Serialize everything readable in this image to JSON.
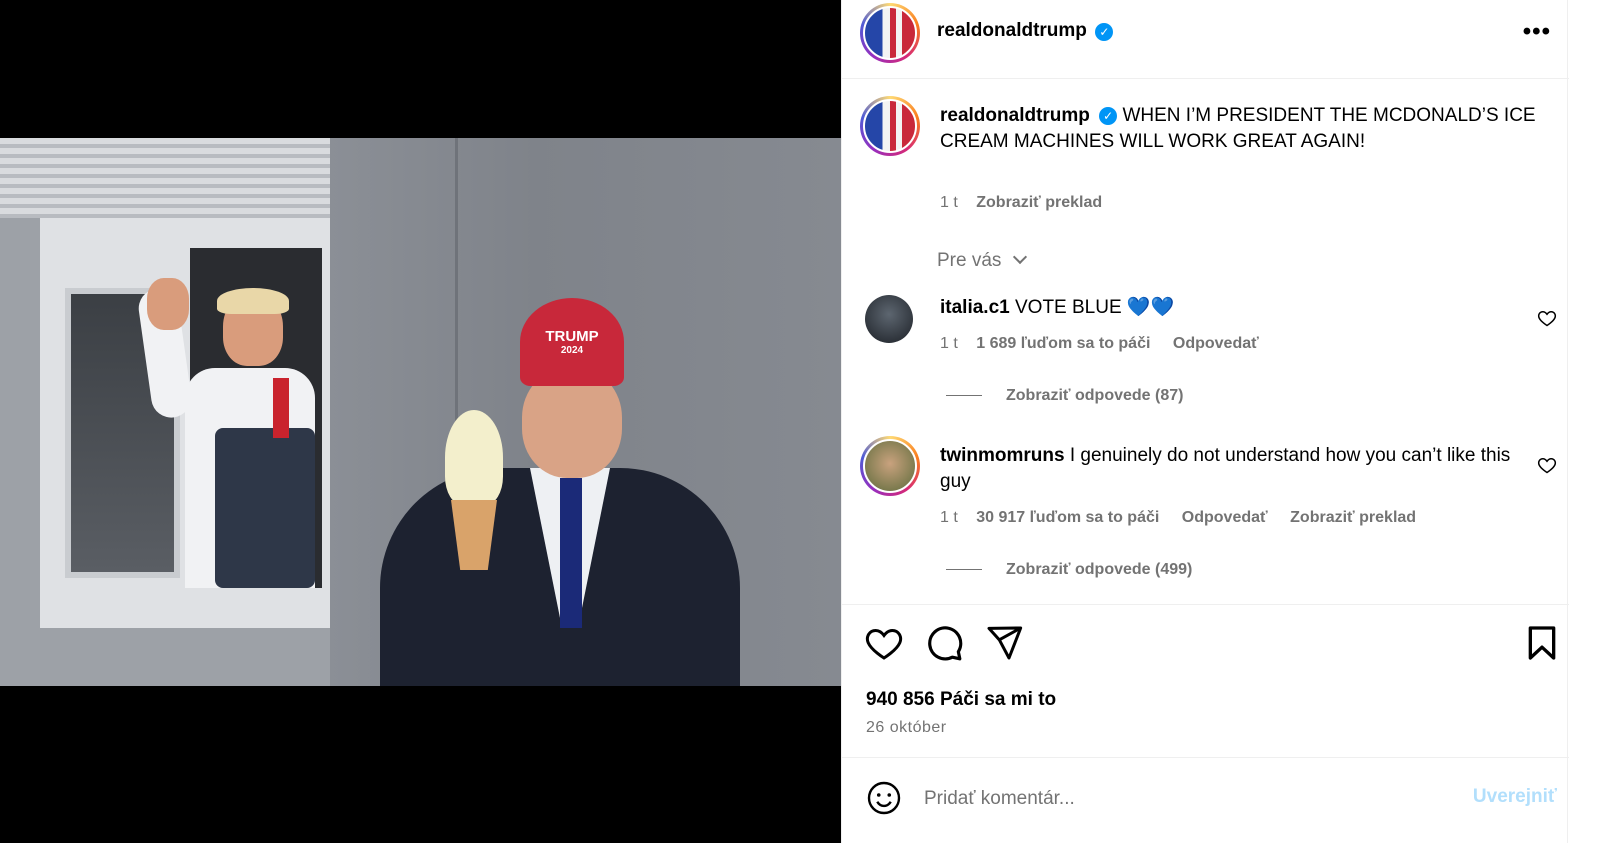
{
  "post": {
    "username": "realdonaldtrump",
    "verified_icon": "verified-badge-icon",
    "more_icon": "more-options-icon",
    "photo_cap_text": "TRUMP",
    "photo_cap_year": "2024"
  },
  "caption": {
    "username": "realdonaldtrump",
    "text": "WHEN I’M PRESIDENT THE MCDONALD’S ICE CREAM MACHINES WILL WORK GREAT AGAIN!",
    "time": "1 t",
    "translate": "Zobraziť preklad"
  },
  "filter": {
    "label": "Pre vás"
  },
  "comments": [
    {
      "username": "italia.c1",
      "text": "VOTE BLUE 💙💙",
      "time": "1 t",
      "likes": "1 689 ľuďom sa to páči",
      "reply": "Odpovedať",
      "view_replies": "Zobraziť odpovede (87)"
    },
    {
      "username": "twinmomruns",
      "text": "I genuinely do not understand how you can’t like this guy",
      "time": "1 t",
      "likes": "30 917 ľuďom sa to páči",
      "reply": "Odpovedať",
      "translate": "Zobraziť preklad",
      "view_replies": "Zobraziť odpovede (499)"
    }
  ],
  "stats": {
    "likes": "940 856 Páči sa mi to",
    "date": "26 október"
  },
  "comment_box": {
    "placeholder": "Pridať komentár...",
    "post_label": "Uverejniť"
  }
}
